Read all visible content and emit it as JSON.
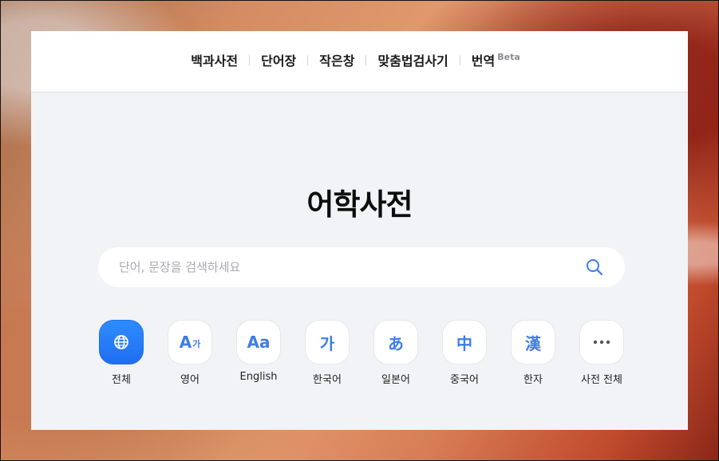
{
  "nav": {
    "items": [
      {
        "label": "백과사전"
      },
      {
        "label": "단어장"
      },
      {
        "label": "작은창"
      },
      {
        "label": "맞춤법검사기"
      },
      {
        "label": "번역",
        "badge": "Beta"
      }
    ]
  },
  "main": {
    "title": "어학사전",
    "search": {
      "placeholder": "단어, 문장을 검색하세요",
      "value": ""
    },
    "categories": [
      {
        "label": "전체",
        "icon": "globe-icon",
        "active": true
      },
      {
        "label": "영어",
        "icon_text": "A",
        "icon_small": "가",
        "icon": "english-korean-icon"
      },
      {
        "label": "English",
        "icon_text": "Aa",
        "icon": "english-icon"
      },
      {
        "label": "한국어",
        "icon_text": "가",
        "icon": "korean-icon"
      },
      {
        "label": "일본어",
        "icon_text": "あ",
        "icon": "japanese-icon"
      },
      {
        "label": "중국어",
        "icon_text": "中",
        "icon": "chinese-icon"
      },
      {
        "label": "한자",
        "icon_text": "漢",
        "icon": "hanja-icon"
      },
      {
        "label": "사전 전체",
        "icon": "more-icon"
      }
    ]
  },
  "colors": {
    "accent": "#1f6ef0",
    "panel": "#f2f3f6"
  }
}
